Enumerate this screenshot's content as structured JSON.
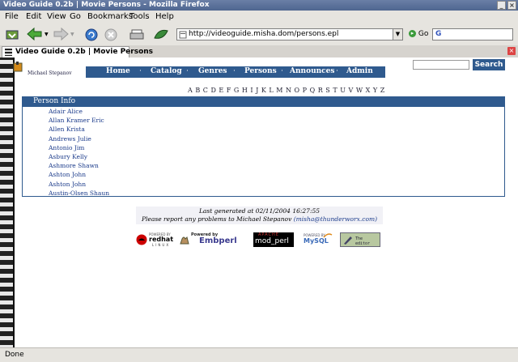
{
  "window": {
    "title": "Video Guide 0.2b | Movie Persons - Mozilla Firefox"
  },
  "menu": {
    "items": [
      "File",
      "Edit",
      "View",
      "Go",
      "Bookmarks",
      "Tools",
      "Help"
    ]
  },
  "toolbar": {
    "url": "http://videoguide.misha.dom/persons.epl",
    "go_label": "Go"
  },
  "tab": {
    "label": "Video Guide 0.2b | Movie Persons"
  },
  "site": {
    "brand": "Michael Stepanov",
    "nav": [
      "Home",
      "Catalog",
      "Genres",
      "Persons",
      "Announces",
      "Admin"
    ],
    "search_button": "Search",
    "letters": [
      "A",
      "B",
      "C",
      "D",
      "E",
      "F",
      "G",
      "H",
      "I",
      "J",
      "K",
      "L",
      "M",
      "N",
      "O",
      "P",
      "Q",
      "R",
      "S",
      "T",
      "U",
      "V",
      "W",
      "X",
      "Y",
      "Z"
    ],
    "section_title": "Person Info",
    "persons": [
      "Adair Alice",
      "Allan Kramer Eric",
      "Allen Krista",
      "Andrews Julie",
      "Antonio Jim",
      "Asbury Kelly",
      "Ashmore Shawn",
      "Ashton John",
      "Ashton John",
      "Austin-Olsen Shaun"
    ],
    "footer": {
      "generated": "Last generated at 02/11/2004 16:27:55",
      "report_prefix": "Please report any problems to Michael Stepanov",
      "email": "(misha@thunderworx.com)"
    },
    "logos": {
      "redhat_top": "POWERED BY",
      "redhat_name": "redhat",
      "redhat_sub": "LINUX",
      "embperl_top": "Powered by",
      "embperl_name": "Embperl",
      "modperl_top": "APACHE",
      "modperl_name": "mod_perl",
      "mysql_top": "POWERED BY",
      "mysql_name": "MySQL",
      "editor_name": "The editor"
    }
  },
  "status": {
    "text": "Done"
  },
  "colors": {
    "nav_blue": "#2f5a8e",
    "link_blue": "#1a3a8a"
  }
}
